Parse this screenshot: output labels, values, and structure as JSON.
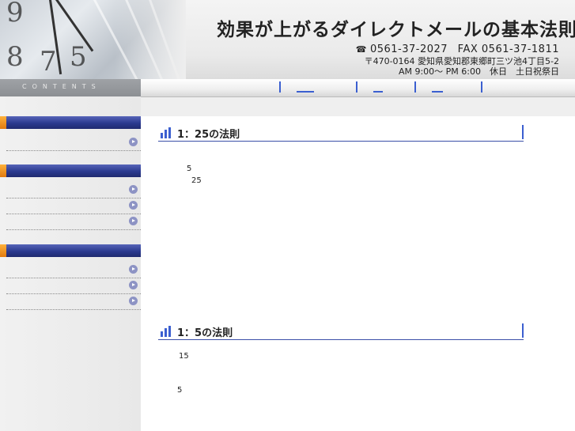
{
  "header": {
    "site_title": "効果が上がるダイレクトメールの基本法則",
    "tel": "0561-37-2027",
    "fax_label": "FAX",
    "fax": "0561-37-1811",
    "address": "〒470-0164 愛知県愛知郡東郷町三ツ池4丁目5-2",
    "hours": "AM 9:00～ PM 6:00　休日　土日祝祭日",
    "phone_icon": "phone-icon"
  },
  "sidebar": {
    "contents_label": "CONTENTS",
    "groups": [
      {
        "items": [
          ""
        ]
      },
      {
        "items": [
          "",
          "",
          ""
        ]
      },
      {
        "items": [
          "",
          "",
          ""
        ]
      }
    ]
  },
  "nav": {
    "links": [
      "",
      "",
      ""
    ]
  },
  "sections": [
    {
      "title": "1：25の法則",
      "lines": [
        "5",
        "25"
      ]
    },
    {
      "title": "1：5の法則",
      "lines": [
        "15",
        "5"
      ]
    }
  ],
  "colors": {
    "accent": "#3b5fd0",
    "sidebar_head": "#2b3a8f",
    "tab": "#f08c1a"
  }
}
